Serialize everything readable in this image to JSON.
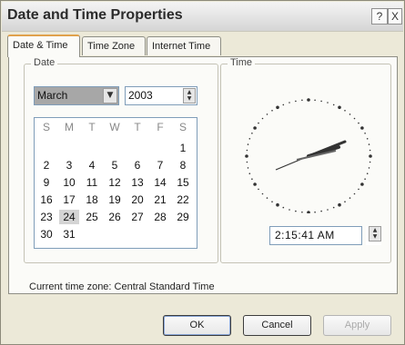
{
  "window": {
    "title": "Date and Time Properties",
    "help": "?",
    "close": "X"
  },
  "tabs": [
    {
      "label": "Date & Time"
    },
    {
      "label": "Time Zone"
    },
    {
      "label": "Internet Time"
    }
  ],
  "date_group": {
    "label": "Date",
    "month": "March",
    "year": "2003",
    "weekdays": [
      "S",
      "M",
      "T",
      "W",
      "T",
      "F",
      "S"
    ],
    "weeks": [
      [
        "",
        "",
        "",
        "",
        "",
        "",
        "1"
      ],
      [
        "2",
        "3",
        "4",
        "5",
        "6",
        "7",
        "8"
      ],
      [
        "9",
        "10",
        "11",
        "12",
        "13",
        "14",
        "15"
      ],
      [
        "16",
        "17",
        "18",
        "19",
        "20",
        "21",
        "22"
      ],
      [
        "23",
        "24",
        "25",
        "26",
        "27",
        "28",
        "29"
      ],
      [
        "30",
        "31",
        "",
        "",
        "",
        "",
        ""
      ]
    ],
    "selected_day": "24"
  },
  "time_group": {
    "label": "Time",
    "time": "2:15:41 AM"
  },
  "current_tz": "Current time zone:  Central Standard Time",
  "buttons": {
    "ok": "OK",
    "cancel": "Cancel",
    "apply": "Apply"
  },
  "colors": {
    "accent_tab": "#e0a14c",
    "month_highlight": "#a7a7a7",
    "field_border": "#7f9db9"
  },
  "icons": {
    "dropdown": "chevron-down-icon",
    "spin": "spin-updown-icon"
  }
}
